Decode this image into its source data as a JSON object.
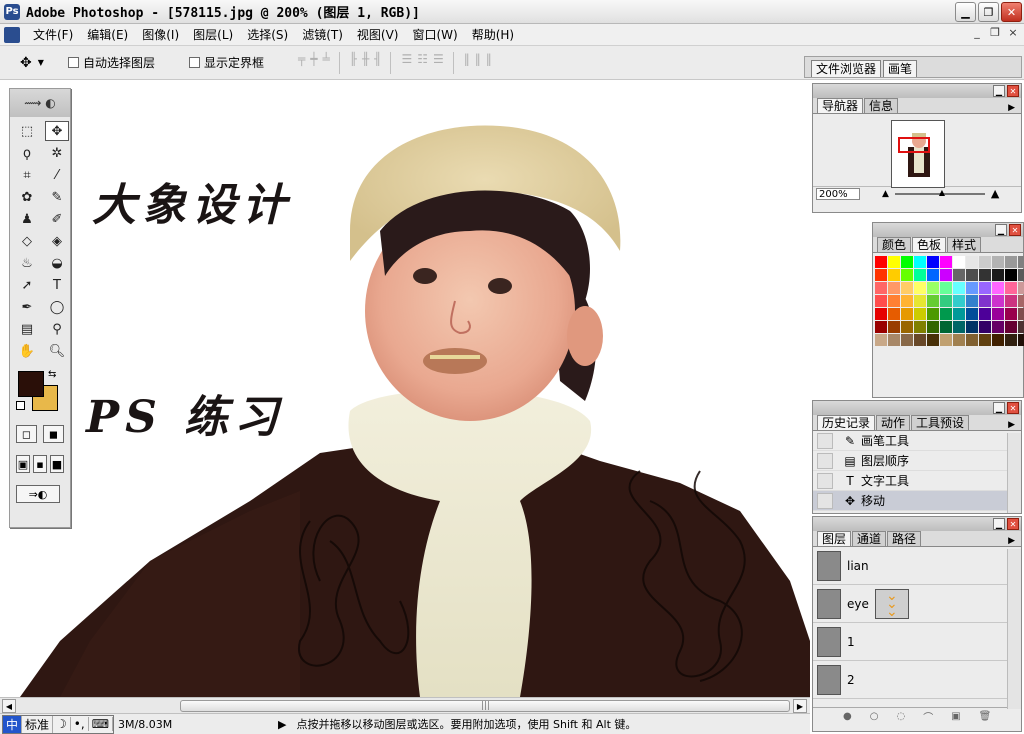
{
  "window": {
    "title": "Adobe Photoshop - [578115.jpg @ 200% (图层 1, RGB)]",
    "minimize": "▁",
    "maximize": "❐",
    "close": "✕"
  },
  "menu": {
    "items": [
      "文件(F)",
      "编辑(E)",
      "图像(I)",
      "图层(L)",
      "选择(S)",
      "滤镜(T)",
      "视图(V)",
      "窗口(W)",
      "帮助(H)"
    ],
    "doc_min": "_",
    "doc_restore": "❐",
    "doc_close": "×"
  },
  "options": {
    "auto_select_layer": "自动选择图层",
    "show_bounding_box": "显示定界框",
    "palette_well_tabs": [
      "文件浏览器",
      "画笔"
    ]
  },
  "canvas_text": {
    "line1": "大象设计",
    "line2": "PS 练习"
  },
  "navigator": {
    "tabs": [
      "导航器",
      "信息"
    ],
    "zoom": "200%"
  },
  "color_palette": {
    "tabs": [
      "颜色",
      "色板",
      "样式"
    ],
    "swatches": [
      "#ff0000",
      "#ffff00",
      "#00ff00",
      "#00ffff",
      "#0000ff",
      "#ff00ff",
      "#ffffff",
      "#e6e6e6",
      "#cccccc",
      "#b3b3b3",
      "#999999",
      "#808080",
      "#ff3300",
      "#ffcc00",
      "#66ff00",
      "#00ff99",
      "#0066ff",
      "#cc00ff",
      "#666666",
      "#4d4d4d",
      "#333333",
      "#1a1a1a",
      "#000000",
      "#5a5a5a",
      "#ff6666",
      "#ff9966",
      "#ffcc66",
      "#ffff66",
      "#99ff66",
      "#66ff99",
      "#66ffff",
      "#6699ff",
      "#9966ff",
      "#ff66ff",
      "#ff6699",
      "#cc9999",
      "#ff4d4d",
      "#ff8033",
      "#ffb333",
      "#e6e633",
      "#66cc33",
      "#33cc80",
      "#33cccc",
      "#3380cc",
      "#8033cc",
      "#cc33cc",
      "#cc3380",
      "#a66666",
      "#e60000",
      "#e65c00",
      "#e69900",
      "#cccc00",
      "#4d9900",
      "#00994d",
      "#009999",
      "#004d99",
      "#4d0099",
      "#990099",
      "#99004d",
      "#804d4d",
      "#990000",
      "#993d00",
      "#996600",
      "#808000",
      "#336600",
      "#006633",
      "#006666",
      "#003366",
      "#330066",
      "#660066",
      "#660033",
      "#4d3333",
      "#c8a888",
      "#a88868",
      "#886848",
      "#684828",
      "#483008",
      "#c0a070",
      "#a08050",
      "#806030",
      "#604010",
      "#402000",
      "#302010",
      "#201008"
    ]
  },
  "history": {
    "tabs": [
      "历史记录",
      "动作",
      "工具预设"
    ],
    "items": [
      {
        "icon": "brush-icon",
        "glyph": "✎",
        "label": "画笔工具"
      },
      {
        "icon": "layer-order-icon",
        "glyph": "▤",
        "label": "图层顺序"
      },
      {
        "icon": "type-tool-icon",
        "glyph": "T",
        "label": "文字工具"
      },
      {
        "icon": "move-tool-icon",
        "glyph": "✥",
        "label": "移动"
      }
    ]
  },
  "layers": {
    "tabs": [
      "图层",
      "通道",
      "路径"
    ],
    "items": [
      {
        "label": "lian"
      },
      {
        "label": "eye"
      },
      {
        "label": "1"
      },
      {
        "label": "2"
      }
    ]
  },
  "status": {
    "ime_label": "标准",
    "doc_size": "3M/8.03M",
    "message": "点按并拖移以移动图层或选区。要用附加选项，使用 Shift 和 Alt 键。"
  }
}
